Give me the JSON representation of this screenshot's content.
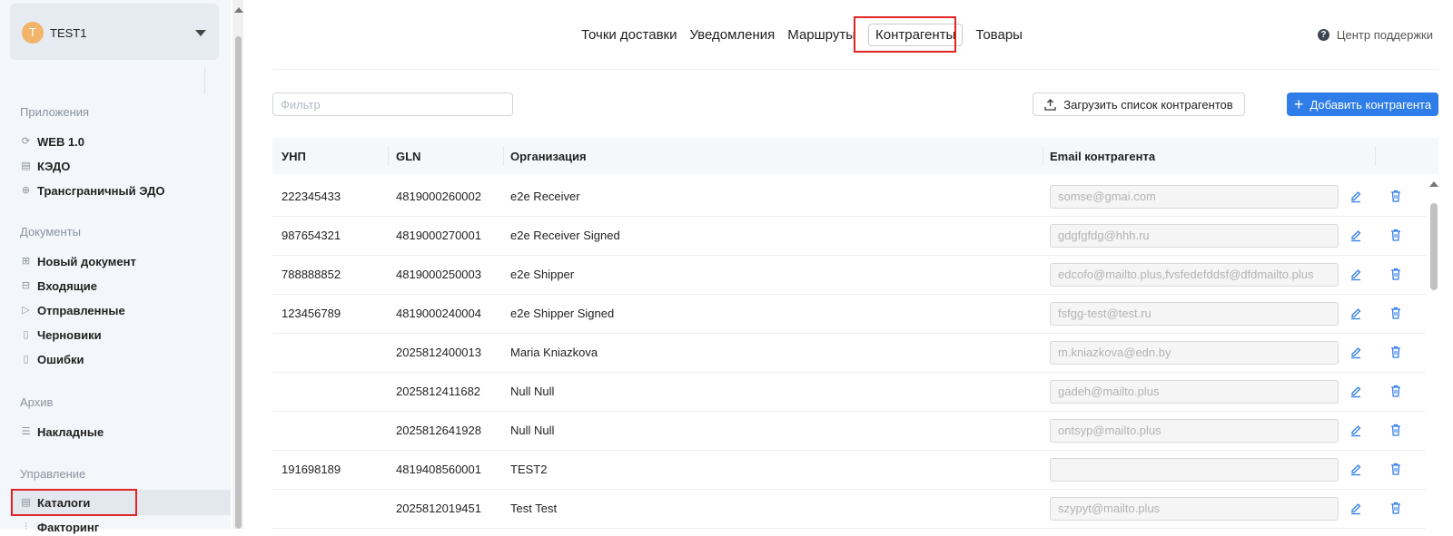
{
  "user": {
    "initial": "T",
    "name": "TEST1"
  },
  "sidebar": {
    "sections": [
      {
        "title": "Приложения",
        "items": [
          {
            "label": "WEB 1.0",
            "icon": "refresh-icon"
          },
          {
            "label": "КЭДО",
            "icon": "document-list-icon"
          },
          {
            "label": "Трансграничный ЭДО",
            "icon": "globe-icon"
          }
        ]
      },
      {
        "title": "Документы",
        "items": [
          {
            "label": "Новый документ",
            "icon": "new-document-icon"
          },
          {
            "label": "Входящие",
            "icon": "inbox-icon"
          },
          {
            "label": "Отправленные",
            "icon": "send-icon"
          },
          {
            "label": "Черновики",
            "icon": "file-icon"
          },
          {
            "label": "Ошибки",
            "icon": "file-icon"
          }
        ]
      },
      {
        "title": "Архив",
        "items": [
          {
            "label": "Накладные",
            "icon": "list-icon"
          }
        ]
      },
      {
        "title": "Управление",
        "items": [
          {
            "label": "Каталоги",
            "icon": "catalog-icon"
          },
          {
            "label": "Факторинг",
            "icon": "chart-icon"
          }
        ]
      }
    ]
  },
  "tabs": [
    "Точки доставки",
    "Уведомления",
    "Маршруты",
    "Контрагенты",
    "Товары"
  ],
  "active_tab": "Контрагенты",
  "support_label": "Центр поддержки",
  "toolbar": {
    "filter_placeholder": "Фильтр",
    "upload_label": "Загрузить список контрагентов",
    "add_label": "Добавить контрагента"
  },
  "table": {
    "headers": [
      "УНП",
      "GLN",
      "Организация",
      "Email контрагента"
    ],
    "rows": [
      {
        "unp": "222345433",
        "gln": "4819000260002",
        "org": "e2e Receiver",
        "email": "somse@gmai.com"
      },
      {
        "unp": "987654321",
        "gln": "4819000270001",
        "org": "e2e Receiver Signed",
        "email": "gdgfgfdg@hhh.ru"
      },
      {
        "unp": "788888852",
        "gln": "4819000250003",
        "org": "e2e Shipper",
        "email": "edcofo@mailto.plus,fvsfedefddsf@dfdmailto.plus"
      },
      {
        "unp": "123456789",
        "gln": "4819000240004",
        "org": "e2e Shipper Signed",
        "email": "fsfgg-test@test.ru"
      },
      {
        "unp": "",
        "gln": "2025812400013",
        "org": "Maria Kniazkova",
        "email": "m.kniazkova@edn.by"
      },
      {
        "unp": "",
        "gln": "2025812411682",
        "org": "Null Null",
        "email": "gadeh@mailto.plus"
      },
      {
        "unp": "",
        "gln": "2025812641928",
        "org": "Null Null",
        "email": "ontsyp@mailto.plus"
      },
      {
        "unp": "191698189",
        "gln": "4819408560001",
        "org": "TEST2",
        "email": ""
      },
      {
        "unp": "",
        "gln": "2025812019451",
        "org": "Test Test",
        "email": "szypyt@mailto.plus"
      }
    ]
  },
  "colors": {
    "accent": "#2f7de8",
    "highlight": "#e02424",
    "sidebar_bg": "#f3f6fa"
  }
}
